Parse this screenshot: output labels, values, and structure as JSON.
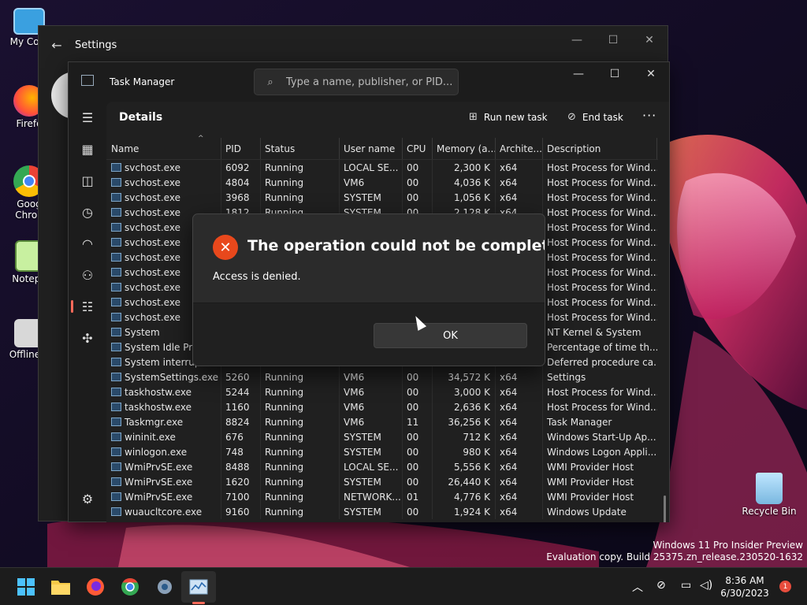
{
  "desktop": {
    "icons": [
      {
        "label": "My Com"
      },
      {
        "label": "Firefo"
      },
      {
        "label": "Goog\nChron"
      },
      {
        "label": "Notepa"
      },
      {
        "label": "OfflineIn"
      }
    ],
    "recycle_bin_label": "Recycle Bin",
    "watermark_line1": "Windows 11 Pro Insider Preview",
    "watermark_line2": "Evaluation copy. Build 25375.zn_release.230520-1632"
  },
  "settings_window": {
    "title": "Settings"
  },
  "task_manager": {
    "title": "Task Manager",
    "search_placeholder": "Type a name, publisher, or PID...",
    "page_title": "Details",
    "commands": {
      "run_new_task": "Run new task",
      "end_task": "End task"
    },
    "columns": [
      "Name",
      "PID",
      "Status",
      "User name",
      "CPU",
      "Memory (a...",
      "Archite...",
      "Description"
    ],
    "rows": [
      [
        "svchost.exe",
        "6092",
        "Running",
        "LOCAL SE...",
        "00",
        "2,300 K",
        "x64",
        "Host Process for Wind..."
      ],
      [
        "svchost.exe",
        "4804",
        "Running",
        "VM6",
        "00",
        "4,036 K",
        "x64",
        "Host Process for Wind..."
      ],
      [
        "svchost.exe",
        "3968",
        "Running",
        "SYSTEM",
        "00",
        "1,056 K",
        "x64",
        "Host Process for Wind..."
      ],
      [
        "svchost.exe",
        "1812",
        "Running",
        "SYSTEM",
        "00",
        "2,128 K",
        "x64",
        "Host Process for Wind..."
      ],
      [
        "svchost.exe",
        "",
        "",
        "",
        "",
        "",
        "",
        "Host Process for Wind..."
      ],
      [
        "svchost.exe",
        "",
        "",
        "",
        "",
        "",
        "",
        "Host Process for Wind..."
      ],
      [
        "svchost.exe",
        "",
        "",
        "",
        "",
        "",
        "",
        "Host Process for Wind..."
      ],
      [
        "svchost.exe",
        "",
        "",
        "",
        "",
        "",
        "",
        "Host Process for Wind..."
      ],
      [
        "svchost.exe",
        "",
        "",
        "",
        "",
        "",
        "",
        "Host Process for Wind..."
      ],
      [
        "svchost.exe",
        "",
        "",
        "",
        "",
        "",
        "",
        "Host Process for Wind..."
      ],
      [
        "svchost.exe",
        "",
        "",
        "",
        "",
        "",
        "",
        "Host Process for Wind..."
      ],
      [
        "System",
        "",
        "",
        "",
        "",
        "",
        "",
        "NT Kernel & System"
      ],
      [
        "System Idle Proc",
        "",
        "",
        "",
        "",
        "",
        "",
        "Percentage of time th..."
      ],
      [
        "System interrupt",
        "",
        "",
        "",
        "",
        "",
        "",
        "Deferred procedure ca..."
      ],
      [
        "SystemSettings.exe",
        "5260",
        "Running",
        "VM6",
        "00",
        "34,572 K",
        "x64",
        "Settings"
      ],
      [
        "taskhostw.exe",
        "5244",
        "Running",
        "VM6",
        "00",
        "3,000 K",
        "x64",
        "Host Process for Wind..."
      ],
      [
        "taskhostw.exe",
        "1160",
        "Running",
        "VM6",
        "00",
        "2,636 K",
        "x64",
        "Host Process for Wind..."
      ],
      [
        "Taskmgr.exe",
        "8824",
        "Running",
        "VM6",
        "11",
        "36,256 K",
        "x64",
        "Task Manager"
      ],
      [
        "wininit.exe",
        "676",
        "Running",
        "SYSTEM",
        "00",
        "712 K",
        "x64",
        "Windows Start-Up Ap..."
      ],
      [
        "winlogon.exe",
        "748",
        "Running",
        "SYSTEM",
        "00",
        "980 K",
        "x64",
        "Windows Logon Appli..."
      ],
      [
        "WmiPrvSE.exe",
        "8488",
        "Running",
        "LOCAL SE...",
        "00",
        "5,556 K",
        "x64",
        "WMI Provider Host"
      ],
      [
        "WmiPrvSE.exe",
        "1620",
        "Running",
        "SYSTEM",
        "00",
        "26,440 K",
        "x64",
        "WMI Provider Host"
      ],
      [
        "WmiPrvSE.exe",
        "7100",
        "Running",
        "NETWORK...",
        "01",
        "4,776 K",
        "x64",
        "WMI Provider Host"
      ],
      [
        "wuaucltcore.exe",
        "9160",
        "Running",
        "SYSTEM",
        "00",
        "1,924 K",
        "x64",
        "Windows Update"
      ]
    ]
  },
  "dialog": {
    "title": "The operation could not be completed.",
    "message": "Access is denied.",
    "ok_label": "OK"
  },
  "taskbar": {
    "time": "8:36 AM",
    "date": "6/30/2023",
    "notification_count": "1"
  },
  "colors": {
    "accent": "#ff6a5a",
    "error": "#e8481c"
  }
}
